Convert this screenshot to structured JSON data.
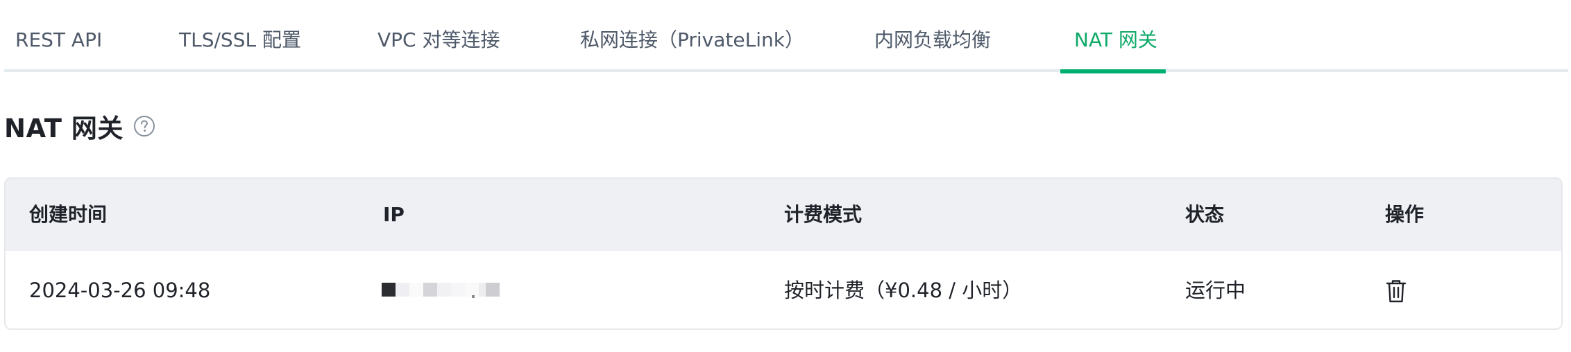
{
  "tabs": [
    {
      "label": "REST API",
      "active": false
    },
    {
      "label": "TLS/SSL 配置",
      "active": false
    },
    {
      "label": "VPC 对等连接",
      "active": false
    },
    {
      "label": "私网连接（PrivateLink）",
      "active": false
    },
    {
      "label": "内网负载均衡",
      "active": false
    },
    {
      "label": "NAT 网关",
      "active": true
    }
  ],
  "section": {
    "title": "NAT 网关",
    "help_icon": "question-circle-icon"
  },
  "table": {
    "headers": {
      "created_at": "创建时间",
      "ip": "IP",
      "billing_mode": "计费模式",
      "status": "状态",
      "actions": "操作"
    },
    "rows": [
      {
        "created_at": "2024-03-26 09:48",
        "ip": "",
        "billing_mode": "按时计费（¥0.48 / 小时）",
        "status": "运行中",
        "action_icon": "trash-icon"
      }
    ]
  },
  "colors": {
    "accent": "#00b070",
    "tab_text": "#4e5969",
    "header_bg": "#eef0f4",
    "border": "#e6e8ec"
  }
}
